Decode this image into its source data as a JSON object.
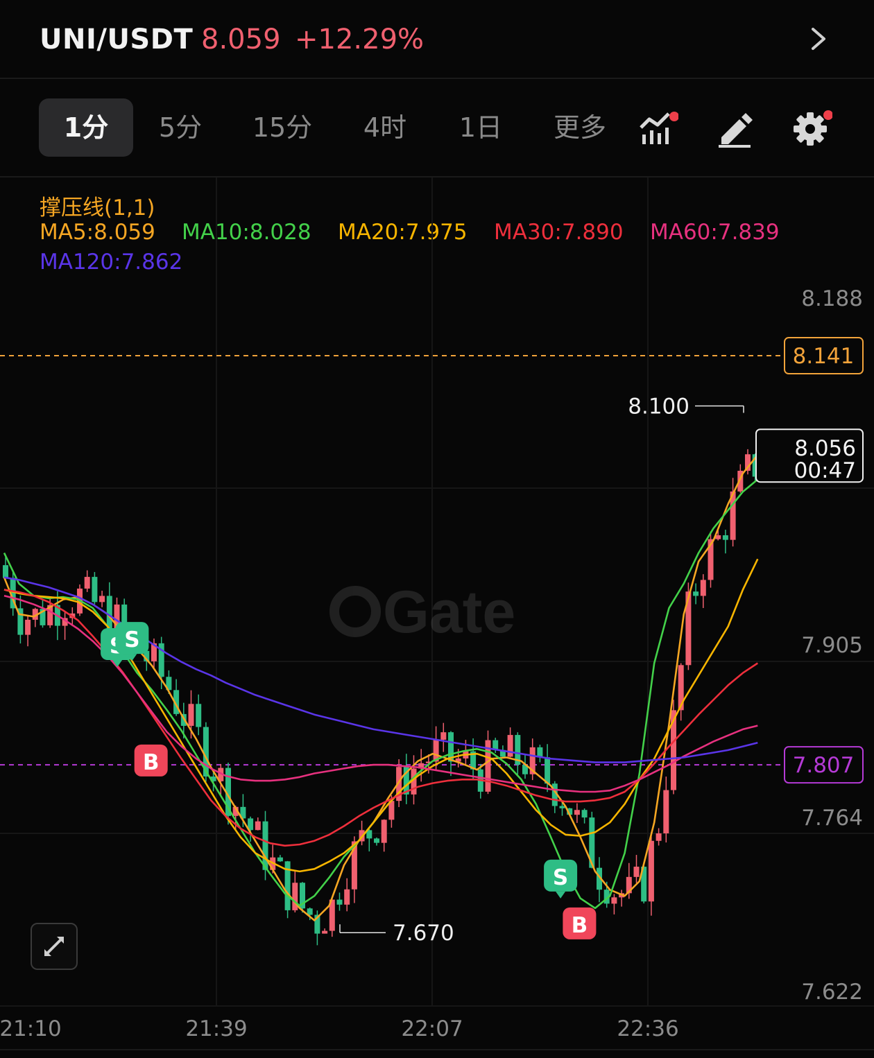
{
  "header": {
    "pair": "UNI/USDT",
    "price": "8.059",
    "change": "+12.29%"
  },
  "toolbar": {
    "tabs": [
      {
        "label": "1分",
        "active": true
      },
      {
        "label": "5分"
      },
      {
        "label": "15分"
      },
      {
        "label": "4时"
      },
      {
        "label": "1日"
      },
      {
        "label": "更多"
      }
    ],
    "icons": [
      "indicator-icon",
      "draw-tool-icon",
      "settings-icon"
    ]
  },
  "legend": {
    "indicator": "撑压线(1,1)",
    "ma": [
      {
        "label": "MA5:8.059",
        "color": "#f5a623"
      },
      {
        "label": "MA10:8.028",
        "color": "#43d14a"
      },
      {
        "label": "MA20:7.975",
        "color": "#f7b500"
      },
      {
        "label": "MA30:7.890",
        "color": "#ee2f3c"
      },
      {
        "label": "MA60:7.839",
        "color": "#e7317f"
      },
      {
        "label": "MA120:7.862",
        "color": "#5a35e8"
      }
    ]
  },
  "colors": {
    "up": "#f0606f",
    "down": "#2ebd85",
    "bg": "#070707"
  },
  "chart_data": {
    "type": "candlestick",
    "y_axis_labels": [
      "8.188",
      "7.905",
      "7.764",
      "7.622"
    ],
    "x_axis_labels": [
      "21:10",
      "21:39",
      "22:07",
      "22:36"
    ],
    "ylim": [
      7.622,
      8.188
    ],
    "resistance_line": {
      "value": 8.141,
      "label": "8.141",
      "color": "#f2a33a"
    },
    "support_line": {
      "value": 7.807,
      "label": "7.807",
      "color": "#b53ad6"
    },
    "high_annotation": {
      "value": 8.1,
      "label": "8.100"
    },
    "low_annotation": {
      "value": 7.67,
      "label": "7.670"
    },
    "current_price_box": {
      "value": 8.056,
      "price": "8.056",
      "countdown": "00:47"
    },
    "ma_lines": {
      "MA5": [
        7.96,
        7.93,
        7.928,
        7.935,
        7.942,
        7.944,
        7.938,
        7.93,
        7.915,
        7.902,
        7.888,
        7.87,
        7.848,
        7.828,
        7.805,
        7.785,
        7.765,
        7.745,
        7.725,
        7.705,
        7.69,
        7.68,
        7.692,
        7.725,
        7.745,
        7.76,
        7.78,
        7.798,
        7.81,
        7.816,
        7.812,
        7.808,
        7.803,
        7.812,
        7.813,
        7.81,
        7.8,
        7.79,
        7.773,
        7.748,
        7.72,
        7.705,
        7.7,
        7.712,
        7.76,
        7.84,
        7.93,
        7.973,
        7.99,
        8.02,
        8.045,
        8.06
      ],
      "MA10": [
        7.98,
        7.955,
        7.945,
        7.943,
        7.944,
        7.942,
        7.935,
        7.92,
        7.9,
        7.882,
        7.868,
        7.852,
        7.835,
        7.815,
        7.795,
        7.775,
        7.755,
        7.735,
        7.718,
        7.702,
        7.692,
        7.7,
        7.715,
        7.732,
        7.745,
        7.76,
        7.775,
        7.788,
        7.8,
        7.81,
        7.815,
        7.818,
        7.82,
        7.817,
        7.808,
        7.795,
        7.775,
        7.748,
        7.72,
        7.698,
        7.69,
        7.7,
        7.735,
        7.8,
        7.89,
        7.935,
        7.955,
        7.98,
        8.0,
        8.015,
        8.03,
        8.04
      ],
      "MA20": [
        7.95,
        7.947,
        7.945,
        7.944,
        7.943,
        7.94,
        7.932,
        7.92,
        7.905,
        7.885,
        7.865,
        7.845,
        7.825,
        7.805,
        7.785,
        7.765,
        7.748,
        7.735,
        7.728,
        7.722,
        7.72,
        7.722,
        7.728,
        7.735,
        7.745,
        7.76,
        7.775,
        7.788,
        7.798,
        7.806,
        7.812,
        7.815,
        7.816,
        7.812,
        7.8,
        7.785,
        7.77,
        7.758,
        7.75,
        7.749,
        7.752,
        7.76,
        7.775,
        7.795,
        7.812,
        7.836,
        7.86,
        7.88,
        7.9,
        7.92,
        7.95,
        7.975
      ],
      "MA30": [
        7.95,
        7.948,
        7.945,
        7.94,
        7.933,
        7.925,
        7.912,
        7.898,
        7.883,
        7.866,
        7.848,
        7.83,
        7.812,
        7.795,
        7.778,
        7.765,
        7.755,
        7.748,
        7.743,
        7.741,
        7.742,
        7.745,
        7.75,
        7.757,
        7.765,
        7.772,
        7.778,
        7.784,
        7.789,
        7.792,
        7.794,
        7.795,
        7.795,
        7.793,
        7.79,
        7.786,
        7.782,
        7.779,
        7.777,
        7.777,
        7.778,
        7.78,
        7.785,
        7.795,
        7.808,
        7.822,
        7.835,
        7.848,
        7.86,
        7.872,
        7.882,
        7.89
      ],
      "MA60": [
        7.945,
        7.942,
        7.938,
        7.933,
        7.926,
        7.918,
        7.908,
        7.896,
        7.882,
        7.866,
        7.85,
        7.834,
        7.822,
        7.812,
        7.804,
        7.798,
        7.795,
        7.794,
        7.794,
        7.795,
        7.797,
        7.8,
        7.802,
        7.804,
        7.806,
        7.807,
        7.807,
        7.806,
        7.805,
        7.803,
        7.801,
        7.799,
        7.797,
        7.795,
        7.793,
        7.791,
        7.789,
        7.787,
        7.786,
        7.785,
        7.785,
        7.786,
        7.79,
        7.795,
        7.801,
        7.807,
        7.814,
        7.82,
        7.826,
        7.831,
        7.836,
        7.839
      ],
      "MA120": [
        7.96,
        7.958,
        7.955,
        7.952,
        7.948,
        7.944,
        7.938,
        7.93,
        7.922,
        7.914,
        7.906,
        7.898,
        7.891,
        7.885,
        7.88,
        7.874,
        7.869,
        7.864,
        7.86,
        7.856,
        7.852,
        7.848,
        7.845,
        7.842,
        7.839,
        7.836,
        7.834,
        7.832,
        7.83,
        7.828,
        7.826,
        7.824,
        7.822,
        7.82,
        7.818,
        7.816,
        7.814,
        7.812,
        7.811,
        7.81,
        7.809,
        7.809,
        7.809,
        7.81,
        7.811,
        7.812,
        7.813,
        7.815,
        7.817,
        7.819,
        7.822,
        7.825
      ]
    },
    "markers": [
      {
        "type": "S",
        "index": 7,
        "value": 7.905
      },
      {
        "type": "S",
        "index": 8,
        "value": 7.91
      },
      {
        "type": "B",
        "index": 9,
        "value": 7.81
      },
      {
        "type": "S",
        "index": 37,
        "value": 7.716
      },
      {
        "type": "B",
        "index": 38,
        "value": 7.677
      }
    ]
  }
}
